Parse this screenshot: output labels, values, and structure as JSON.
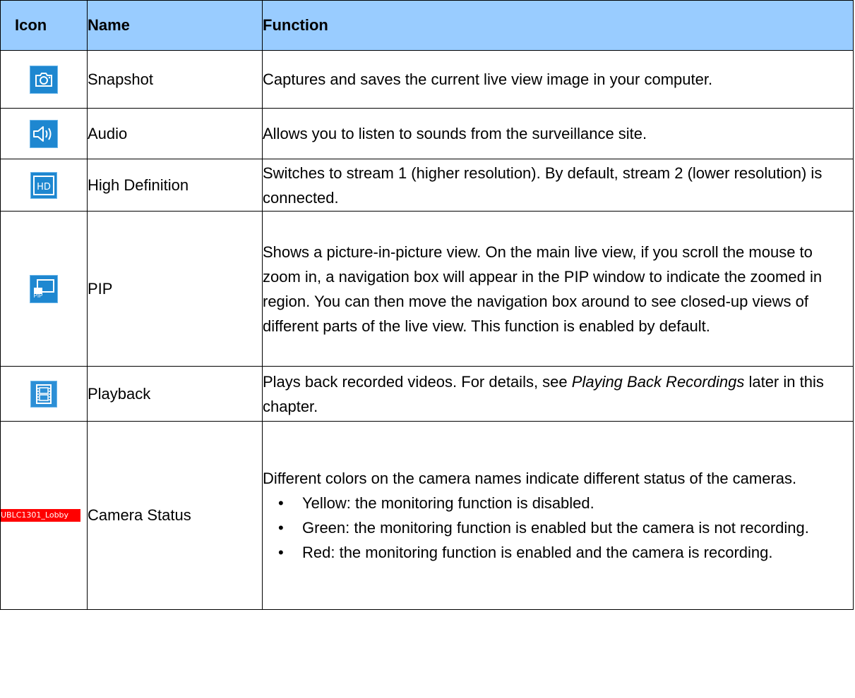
{
  "headers": {
    "icon": "Icon",
    "name": "Name",
    "function": "Function"
  },
  "rows": [
    {
      "icon": "camera-icon",
      "name": "Snapshot",
      "function": "Captures and saves the current live view image in your computer."
    },
    {
      "icon": "speaker-icon",
      "name": "Audio",
      "function": "Allows you to listen to sounds from the surveillance site."
    },
    {
      "icon": "hd-icon",
      "name": "High Definition",
      "function": "Switches to stream 1 (higher resolution). By default, stream 2 (lower resolution) is connected."
    },
    {
      "icon": "pip-icon",
      "icon_text": "PIP",
      "name": "PIP",
      "function": "Shows a picture-in-picture view. On the main live view, if you scroll the mouse to zoom in, a navigation box will appear in the PIP window to indicate the zoomed in region. You can then move the navigation box around to see closed-up views of different parts of the live view. This function is enabled by default."
    },
    {
      "icon": "film-icon",
      "name": "Playback",
      "function_pre": "Plays back recorded videos. For details, see ",
      "function_em": "Playing Back Recordings",
      "function_post": " later in this chapter."
    },
    {
      "icon": "camera-status-label",
      "icon_text": "UBLC1301_Lobby",
      "name": "Camera Status",
      "function_intro": "Different colors on the camera names indicate different status of the cameras.",
      "bullets": [
        "Yellow: the monitoring function is disabled.",
        "Green: the monitoring function is enabled but the camera is not recording.",
        "Red: the monitoring function is enabled and the camera is recording."
      ]
    }
  ],
  "colors": {
    "header_bg": "#99ccff",
    "icon_blue": "#1e87d0",
    "status_red": "#ff0000"
  }
}
